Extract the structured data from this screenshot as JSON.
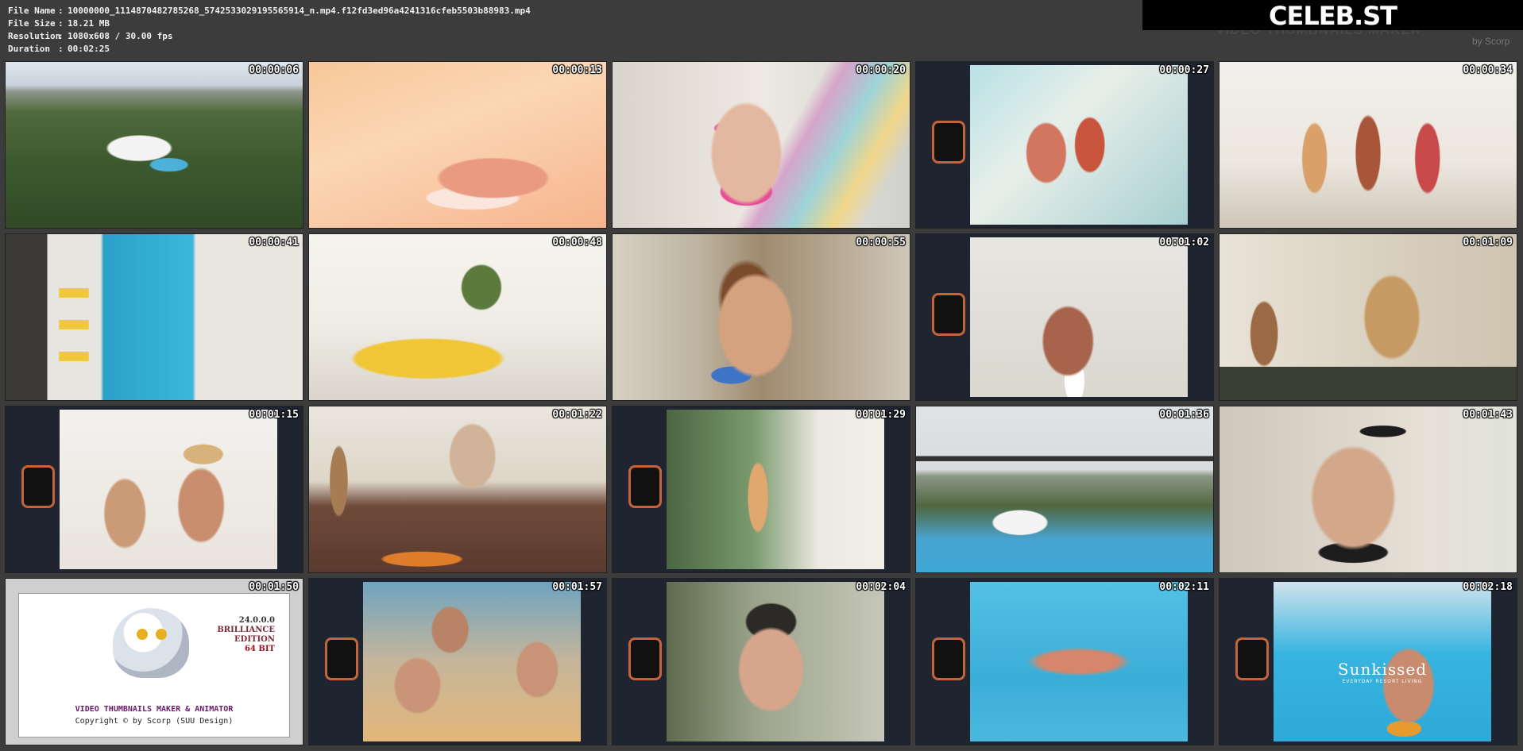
{
  "info": {
    "rows": [
      {
        "label": "File Name",
        "value": "10000000_1114870482785268_5742533029195565914_n.mp4.f12fd3ed96a4241316cfeb5503b88983.mp4"
      },
      {
        "label": "File Size",
        "value": "18.21 MB"
      },
      {
        "label": "Resolution",
        "value": "1080x608 / 30.00 fps"
      },
      {
        "label": "Duration",
        "value": "00:02:25"
      }
    ],
    "separator": ":"
  },
  "logo": {
    "text": "CELEB.ST"
  },
  "watermark": {
    "title": "VIDEO THUMBNAILS MAKER",
    "by": "by Scorp"
  },
  "thumbnails": [
    {
      "time": "00:00:06"
    },
    {
      "time": "00:00:13"
    },
    {
      "time": "00:00:20"
    },
    {
      "time": "00:00:27"
    },
    {
      "time": "00:00:34"
    },
    {
      "time": "00:00:41"
    },
    {
      "time": "00:00:48"
    },
    {
      "time": "00:00:55"
    },
    {
      "time": "00:01:02"
    },
    {
      "time": "00:01:09"
    },
    {
      "time": "00:01:15"
    },
    {
      "time": "00:01:22"
    },
    {
      "time": "00:01:29"
    },
    {
      "time": "00:01:36"
    },
    {
      "time": "00:01:43"
    },
    {
      "time": "00:01:50"
    },
    {
      "time": "00:01:57"
    },
    {
      "time": "00:02:04"
    },
    {
      "time": "00:02:11"
    },
    {
      "time": "00:02:18"
    }
  ],
  "about": {
    "version": "24.0.0.0",
    "edition_line1": "BRILLIANCE",
    "edition_line2": "EDITION",
    "bits": "64 BIT",
    "title": "VIDEO THUMBNAILS MAKER & ANIMATOR",
    "copyright": "Copyright © by Scorp (SUU Design)"
  },
  "overlay_text": {
    "title": "Sunkissed",
    "subtitle": "EVERYDAY RESORT LIVING"
  }
}
